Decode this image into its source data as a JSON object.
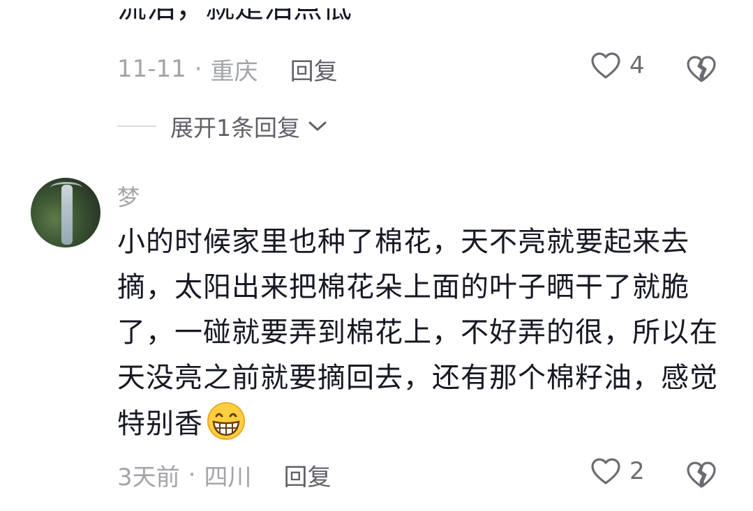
{
  "previous_comment": {
    "text_fragment": "流泪，就是泪点低",
    "date": "11-11",
    "location": "重庆",
    "reply_label": "回复",
    "likes": "4",
    "expand_label": "展开1条回复"
  },
  "comment": {
    "username": "梦",
    "text": "小的时候家里也种了棉花，天不亮就要起来去摘，太阳出来把棉花朵上面的叶子晒干了就脆了，一碰就要弄到棉花上，不好弄的很，所以在天没亮之前就要摘回去，还有那个棉籽油，感觉特别香",
    "emoji": "grinning-face-emoji",
    "date": "3天前",
    "location": "四川",
    "reply_label": "回复",
    "likes": "2"
  },
  "separator": "·"
}
